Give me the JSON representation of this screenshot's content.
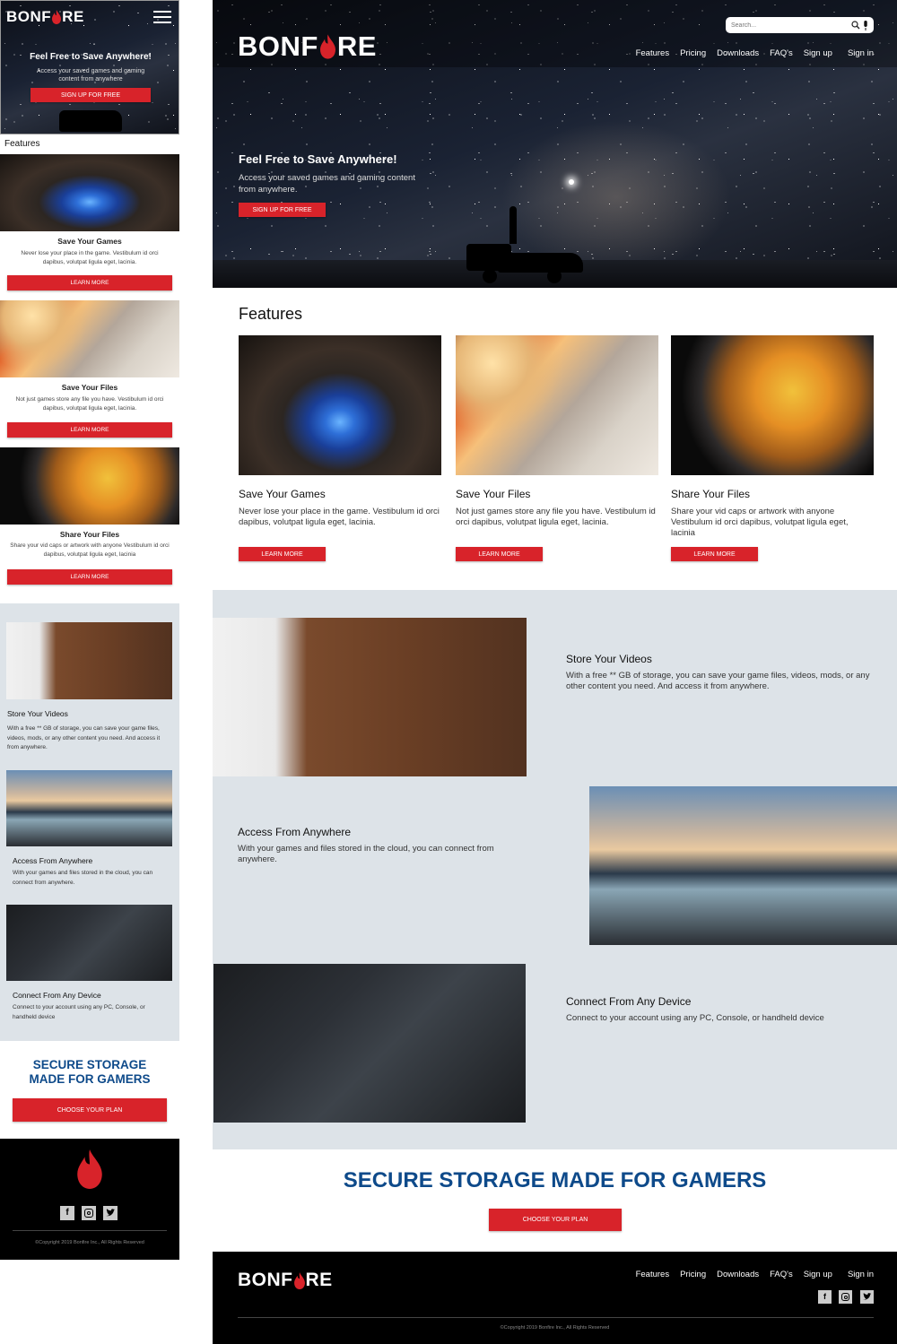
{
  "brand": {
    "logo_left": "BONF",
    "logo_right": "RE",
    "accent_color": "#d8232a",
    "dark_color": "#000000",
    "navy_color": "#0e4a8a"
  },
  "mobile": {
    "hero": {
      "title": "Feel Free to Save Anywhere!",
      "subtitle": "Access your saved games and gaming content from anywhere",
      "cta": "SIGN UP FOR FREE"
    },
    "features_heading": "Features",
    "features": [
      {
        "title": "Save Your Games",
        "text": "Never lose your place in the game. Vestibulum id orci dapibus, volutpat ligula eget, lacinia.",
        "button": "LEARN MORE"
      },
      {
        "title": "Save Your Files",
        "text": "Not just games store any file you have. Vestibulum id orci dapibus, volutpat ligula eget, lacinia.",
        "button": "LEARN MORE"
      },
      {
        "title": "Share Your Files",
        "text": "Share your vid caps or artwork with anyone Vestibulum id orci dapibus, volutpat ligula eget, lacinia",
        "button": "LEARN MORE"
      }
    ],
    "benefits": [
      {
        "title": "Store Your Videos",
        "text": "With a free ** GB of storage, you can save your game files, videos, mods, or any other content you need. And access it from anywhere."
      },
      {
        "title": "Access From Anywhere",
        "text": "With your games and files stored in the cloud, you can connect from anywhere."
      },
      {
        "title": "Connect From Any Device",
        "text": "Connect to your account using any PC, Console, or handheld device"
      }
    ],
    "cta_heading": "SECURE STORAGE MADE FOR GAMERS",
    "cta_button": "CHOOSE YOUR PLAN",
    "copyright": "©Copyright 2019 Bonfire Inc.,  All Rights Reserved"
  },
  "desktop": {
    "search_placeholder": "Search...",
    "nav": [
      "Features",
      "Pricing",
      "Downloads",
      "FAQ's",
      "Sign up",
      "Sign in"
    ],
    "hero": {
      "title": "Feel Free to Save Anywhere!",
      "subtitle": "Access your saved games and gaming content from anywhere.",
      "cta": "SIGN UP FOR FREE"
    },
    "features_heading": "Features",
    "features": [
      {
        "title": "Save Your Games",
        "text": "Never lose your place in the game. Vestibulum id orci dapibus, volutpat ligula eget, lacinia.",
        "button": "LEARN MORE"
      },
      {
        "title": "Save Your Files",
        "text": "Not just games store any file you have. Vestibulum id orci dapibus, volutpat ligula eget, lacinia.",
        "button": "LEARN MORE"
      },
      {
        "title": "Share Your Files",
        "text": "Share your vid caps or artwork with anyone Vestibulum id orci dapibus, volutpat ligula eget, lacinia",
        "button": "LEARN MORE"
      }
    ],
    "benefits": [
      {
        "title": "Store Your Videos",
        "text": "With a free ** GB of storage, you can save your game files, videos, mods, or any other content you need. And access it from anywhere."
      },
      {
        "title": "Access From Anywhere",
        "text": "With your games and files stored in the cloud, you can connect from anywhere."
      },
      {
        "title": "Connect From Any Device",
        "text": "Connect to your account using any PC, Console, or handheld device"
      }
    ],
    "cta_heading": "SECURE STORAGE MADE FOR GAMERS",
    "cta_button": "CHOOSE YOUR PLAN",
    "footer_nav": [
      "Features",
      "Pricing",
      "Downloads",
      "FAQ's",
      "Sign up",
      "Sign in"
    ],
    "social_icons": [
      "facebook-icon",
      "instagram-icon",
      "twitter-icon"
    ],
    "copyright": "©Copyright 2019 Bonfire Inc.,  All Rights Reserved"
  }
}
